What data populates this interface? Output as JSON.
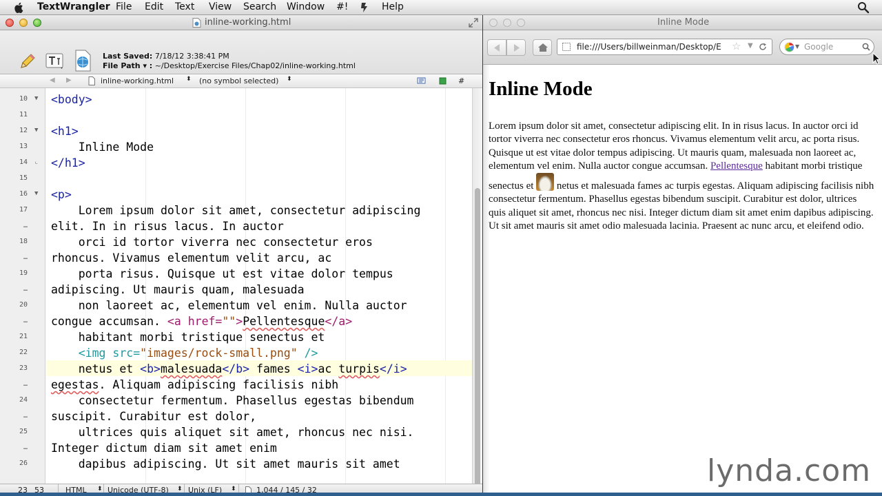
{
  "menubar": {
    "app": "TextWrangler",
    "items": [
      "File",
      "Edit",
      "Text",
      "View",
      "Search",
      "Window",
      "#!",
      "Help"
    ]
  },
  "editor": {
    "window_title": "inline-working.html",
    "last_saved_label": "Last Saved:",
    "last_saved": "7/18/12 3:38:41 PM",
    "file_path_label": "File Path ▾ :",
    "file_path": "~/Desktop/Exercise Files/Chap02/inline-working.html",
    "nav": {
      "file": "inline-working.html",
      "symbol": "(no symbol selected)",
      "hash": "#"
    },
    "line_numbers": [
      {
        "n": "10",
        "fold": "▼"
      },
      {
        "n": "11",
        "fold": ""
      },
      {
        "n": "12",
        "fold": "▼"
      },
      {
        "n": "13",
        "fold": ""
      },
      {
        "n": "14",
        "fold": "⌞"
      },
      {
        "n": "15",
        "fold": ""
      },
      {
        "n": "16",
        "fold": "▼"
      },
      {
        "n": "17",
        "fold": ""
      },
      {
        "n": "…",
        "fold": ""
      },
      {
        "n": "18",
        "fold": ""
      },
      {
        "n": "…",
        "fold": ""
      },
      {
        "n": "19",
        "fold": ""
      },
      {
        "n": "…",
        "fold": ""
      },
      {
        "n": "20",
        "fold": ""
      },
      {
        "n": "…",
        "fold": ""
      },
      {
        "n": "21",
        "fold": ""
      },
      {
        "n": "22",
        "fold": ""
      },
      {
        "n": "23",
        "fold": ""
      },
      {
        "n": "…",
        "fold": ""
      },
      {
        "n": "24",
        "fold": ""
      },
      {
        "n": "…",
        "fold": ""
      },
      {
        "n": "25",
        "fold": ""
      },
      {
        "n": "…",
        "fold": ""
      },
      {
        "n": "26",
        "fold": ""
      }
    ],
    "code": {
      "l1": "<body>",
      "l3": "<h1>",
      "l4": "    Inline Mode",
      "l5": "</h1>",
      "l7": "<p>",
      "l8": "    Lorem ipsum dolor sit amet, consectetur adipiscing",
      "l9": "elit. In in risus lacus. In auctor",
      "l10": "    orci id tortor viverra nec consectetur eros",
      "l11": "rhoncus. Vivamus elementum velit arcu, ac",
      "l12": "    porta risus. Quisque ut est vitae dolor tempus",
      "l13": "adipiscing. Ut mauris quam, malesuada",
      "l14": "    non laoreet ac, elementum vel enim. Nulla auctor",
      "l15_pre": "congue accumsan. ",
      "l15_a_open": "<a",
      "l15_href": " href=",
      "l15_val": "\"\"",
      "l15_gt": ">",
      "l15_text": "Pellentesque",
      "l15_a_close": "</a>",
      "l16": "    habitant morbi tristique senectus et",
      "l17_indent": "    ",
      "l17_tag": "<img src=",
      "l17_val": "\"images/rock-small.png\"",
      "l17_end": " />",
      "l18_pre": "    netus et ",
      "l18_b_open": "<b>",
      "l18_b_text": "malesuada",
      "l18_b_close": "</b>",
      "l18_mid": " fames ",
      "l18_i_open": "<i>",
      "l18_ac": "ac ",
      "l18_turpis": "turpis",
      "l18_i_close": "</i>",
      "l19_egestas": "egestas",
      "l19_rest": ". Aliquam adipiscing facilisis nibh",
      "l20": "    consectetur fermentum. Phasellus egestas bibendum",
      "l21": "suscipit. Curabitur est dolor,",
      "l22": "    ultrices quis aliquet sit amet, rhoncus nec nisi.",
      "l23": "Integer dictum diam sit amet enim",
      "l24": "    dapibus adipiscing. Ut sit amet mauris sit amet"
    },
    "status": {
      "line": "23",
      "column": "53",
      "language": "HTML",
      "encoding": "Unicode (UTF-8)",
      "line_endings": "Unix (LF)",
      "counts": "1,044 / 145 / 32"
    }
  },
  "browser": {
    "window_title": "Inline Mode",
    "url": "file:///Users/billweinman/Desktop/E",
    "search_placeholder": "Google",
    "heading": "Inline Mode",
    "para": {
      "part1": "Lorem ipsum dolor sit amet, consectetur adipiscing elit. In in risus lacus. In auctor orci id tortor viverra nec consectetur eros rhoncus. Vivamus elementum velit arcu, ac porta risus. Quisque ut est vitae dolor tempus adipiscing. Ut mauris quam, malesuada non laoreet ac, elementum vel enim. Nulla auctor congue accumsan. ",
      "link": "Pellentesque",
      "part2": " habitant morbi tristique senectus et ",
      "part3": " netus et malesuada fames ac turpis egestas. Aliquam adipiscing facilisis nibh consectetur fermentum. Phasellus egestas bibendum suscipit. Curabitur est dolor, ultrices quis aliquet sit amet, rhoncus nec nisi. Integer dictum diam sit amet enim dapibus adipiscing. Ut sit amet mauris sit amet odio malesuada lacinia. Praesent ac nunc arcu, et eleifend odio."
    }
  },
  "watermark": "lynda.com"
}
